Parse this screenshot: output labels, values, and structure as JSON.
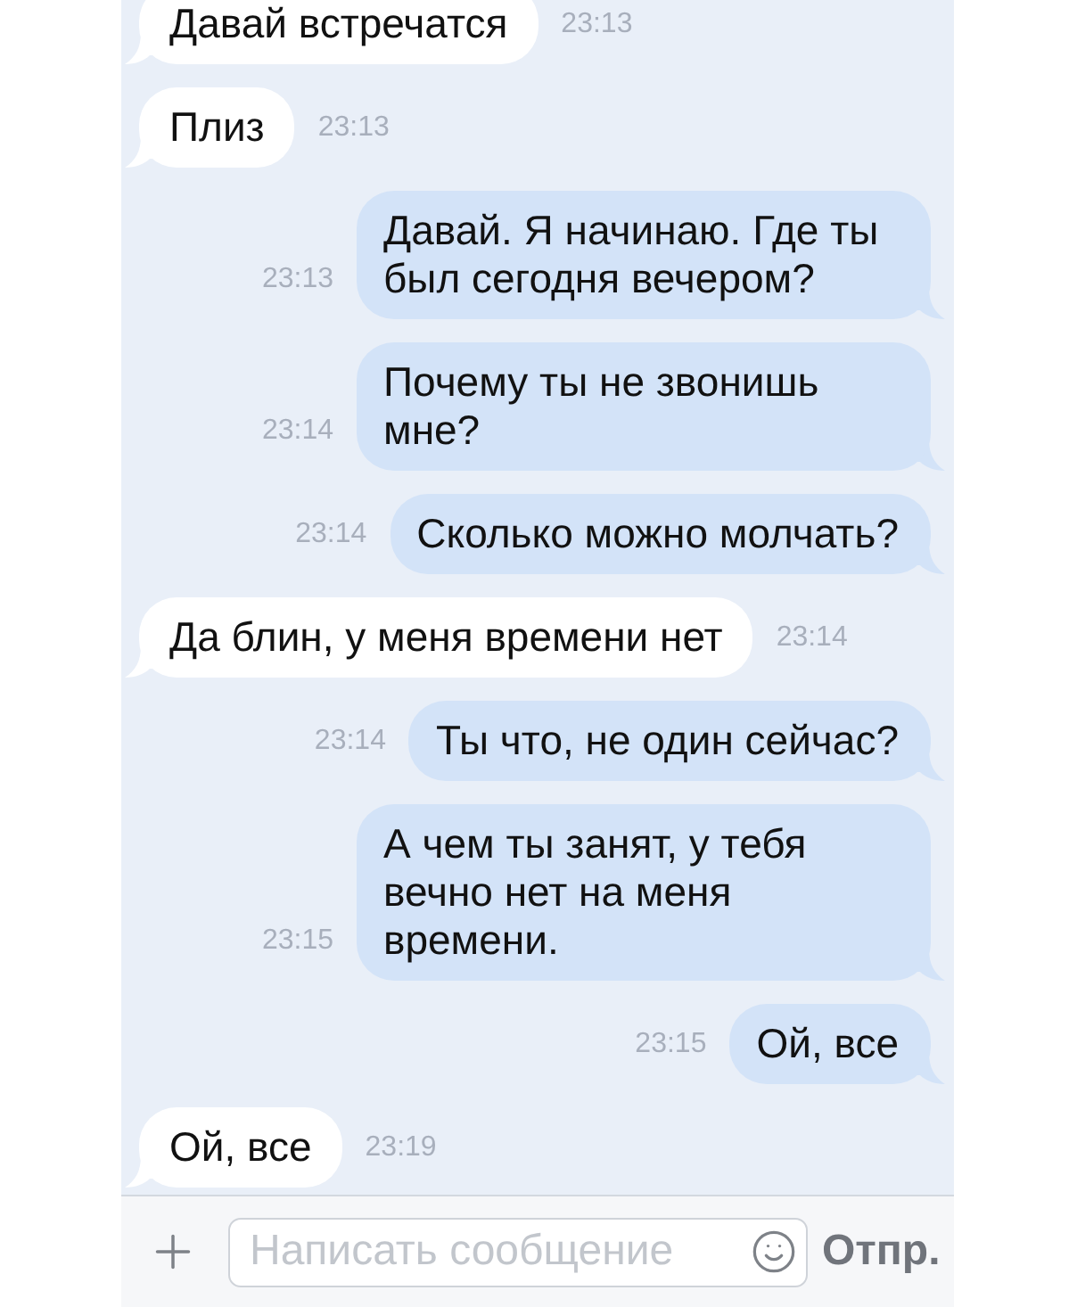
{
  "messages": [
    {
      "kind": "incoming",
      "text": "Давай встречатся",
      "time": "23:13"
    },
    {
      "kind": "incoming",
      "text": "Плиз",
      "time": "23:13"
    },
    {
      "kind": "outgoing",
      "text": "Давай. Я начинаю. Где ты был сегодня вечером?",
      "time": "23:13"
    },
    {
      "kind": "outgoing",
      "text": "Почему ты не звонишь мне?",
      "time": "23:14"
    },
    {
      "kind": "outgoing",
      "text": "Сколько можно молчать?",
      "time": "23:14"
    },
    {
      "kind": "incoming",
      "text": "Да блин, у меня времени нет",
      "time": "23:14"
    },
    {
      "kind": "outgoing",
      "text": "Ты что, не один сейчас?",
      "time": "23:14"
    },
    {
      "kind": "outgoing",
      "text": "А чем ты занят, у тебя вечно нет на меня времени.",
      "time": "23:15"
    },
    {
      "kind": "outgoing",
      "text": "Ой, все",
      "time": "23:15"
    },
    {
      "kind": "incoming",
      "text": "Ой, все",
      "time": "23:19"
    }
  ],
  "composer": {
    "placeholder": "Написать сообщение",
    "send_label": "Отпр."
  }
}
